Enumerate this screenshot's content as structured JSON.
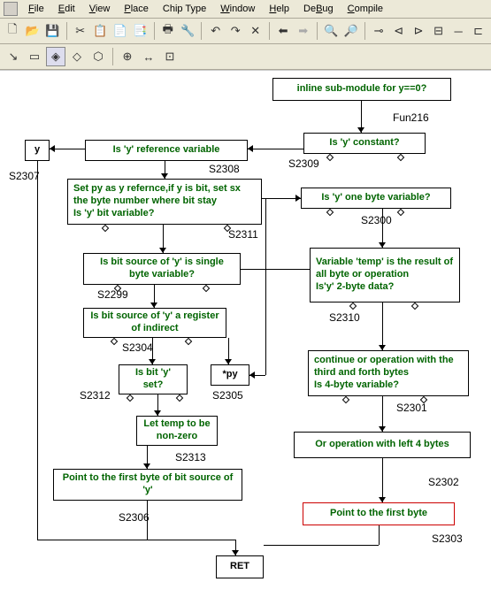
{
  "menu": {
    "items": [
      "File",
      "Edit",
      "View",
      "Place",
      "Chip Type",
      "Window",
      "Help",
      "DeBug",
      "Compile"
    ]
  },
  "toolbar1": {
    "new": "🗋",
    "open": "📂",
    "save": "💾",
    "cut": "✂",
    "copy": "📋",
    "paste": "📄",
    "paste2": "📑",
    "print": "🖶",
    "tool": "🔧",
    "undo": "↶",
    "redo": "↷",
    "delete": "✕",
    "back": "⬅",
    "fwd": "➡",
    "zoomin": "🔍",
    "zoomout": "🔎",
    "a1": "⊸",
    "a2": "⊲",
    "a3": "⊳",
    "a4": "⊟",
    "a5": "─",
    "a6": "⊏"
  },
  "toolbar2": {
    "b1": "↘",
    "b2": "▭",
    "b3": "◈",
    "b4": "◇",
    "b5": "⬡",
    "b6": "⊕",
    "b7": "↔",
    "b8": "⊡"
  },
  "nodes": {
    "n_inline": "inline sub-module for y==0?",
    "n_isconst": "Is 'y' constant?",
    "n_isref": "Is 'y' reference variable",
    "n_y": "y",
    "n_setpy": "Set py as y refernce,if y is bit, set sx the byte number where bit stay\nIs 'y' bit variable?",
    "n_isone": "Is 'y' one byte variable?",
    "n_bitsrc": "Is bit source of  'y' is single byte variable?",
    "n_temp": "Variable 'temp'  is the result of all byte or operation\nIs'y'  2-byte data?",
    "n_reg": "Is bit source of 'y' a register of indirect",
    "n_bitset": "Is bit  'y' set?",
    "n_py": "*py",
    "n_cont": "continue or operation with the third and forth bytes\nIs 4-byte variable?",
    "n_lettemp": "Let temp to be  non-zero",
    "n_orop": "Or operation with left 4 bytes",
    "n_ptrbit": "Point to the first byte of bit source of  'y'",
    "n_ptrfirst": "Point to the first byte",
    "n_ret": "RET"
  },
  "labels": {
    "fun216": "Fun216",
    "s2307": "S2307",
    "s2308": "S2308",
    "s2309": "S2309",
    "s2311": "S2311",
    "s2300": "S2300",
    "s2299": "S2299",
    "s2310": "S2310",
    "s2304": "S2304",
    "s2312": "S2312",
    "s2305": "S2305",
    "s2301": "S2301",
    "s2313": "S2313",
    "s2302": "S2302",
    "s2306": "S2306",
    "s2303": "S2303"
  }
}
